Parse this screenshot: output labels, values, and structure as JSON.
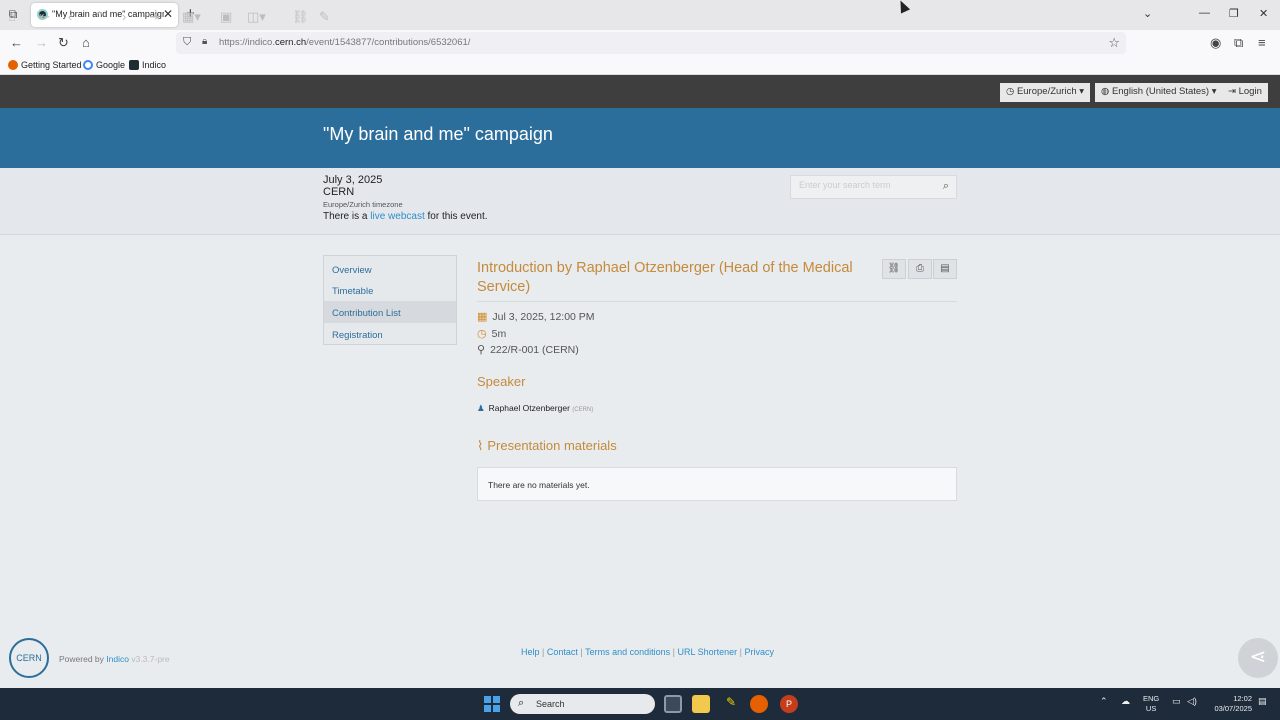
{
  "browser": {
    "tab_title": "\"My brain and me\" campaign | ...",
    "tab_close": "✕",
    "new_tab": "+",
    "url_prefix": "https://indico.",
    "url_domain": "cern.ch",
    "url_path": "/event/1543877/contributions/6532061/",
    "bookmarks": [
      "Getting Started",
      "Google",
      "Indico"
    ]
  },
  "toolbar": {
    "timezone": "Europe/Zurich",
    "language": "English (United States)",
    "login": "Login"
  },
  "event": {
    "title": "\"My brain and me\" campaign",
    "date": "July 3, 2025",
    "venue": "CERN",
    "timezone_note": "Europe/Zurich timezone",
    "webcast_prefix": "There is a ",
    "webcast_link": "live webcast",
    "webcast_suffix": " for this event.",
    "search_placeholder": "Enter your search term"
  },
  "menu": {
    "items": [
      {
        "label": "Overview"
      },
      {
        "label": "Timetable"
      },
      {
        "label": "Contribution List"
      },
      {
        "label": "Registration"
      }
    ],
    "active": "Contribution List"
  },
  "contribution": {
    "title": "Introduction by Raphael Otzenberger (Head of the Medical Service)",
    "datetime": "Jul 3, 2025, 12:00 PM",
    "duration": "5m",
    "room": "222/R-001 (CERN)",
    "speaker_heading": "Speaker",
    "speaker_name": "Raphael Otzenberger",
    "speaker_affiliation": "(CERN)",
    "materials_heading": "Presentation materials",
    "materials_empty": "There are no materials yet."
  },
  "footer": {
    "logo_text": "CERN",
    "powered_by": "Powered by",
    "indico": "Indico",
    "version": "v3.3.7-pre",
    "links": [
      "Help",
      "Contact",
      "Terms and conditions",
      "URL Shortener",
      "Privacy"
    ]
  },
  "taskbar": {
    "search_label": "Search",
    "lang_line1": "ENG",
    "lang_line2": "US",
    "time": "12:02",
    "date": "03/07/2025"
  },
  "colors": {
    "header_blue": "#2c6e9b",
    "accent_orange": "#c58a3a",
    "link_blue": "#2f8fc6",
    "toolbar_dark": "#3e3e3e"
  }
}
